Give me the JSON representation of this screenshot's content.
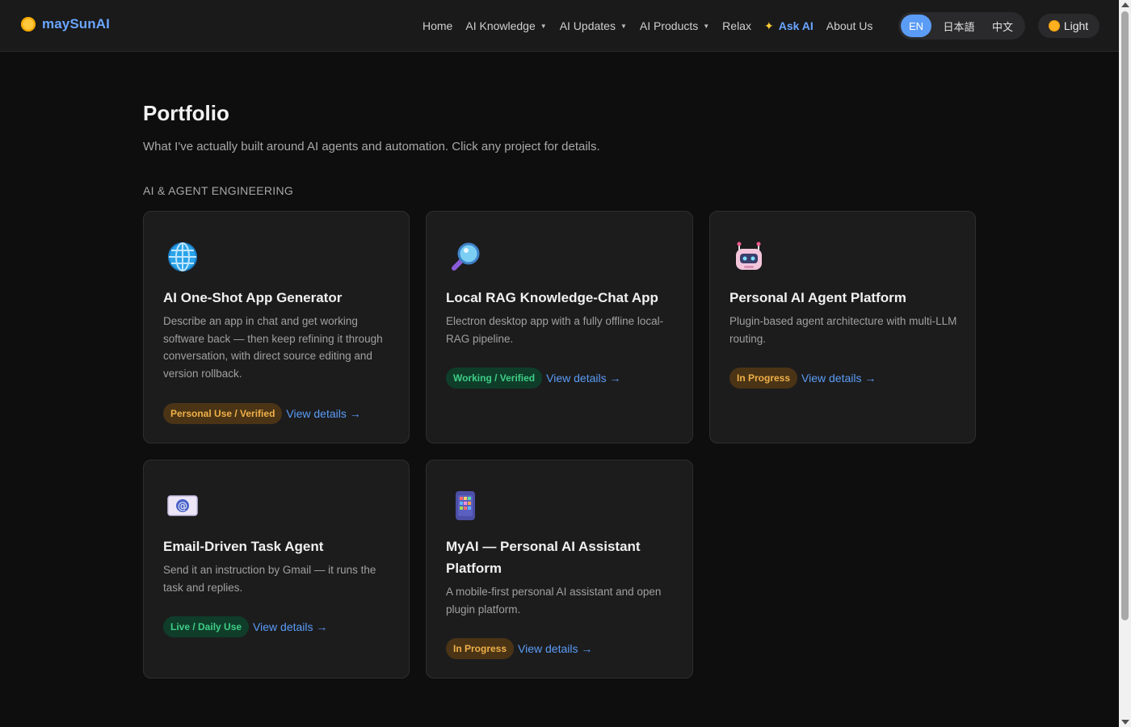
{
  "header": {
    "brand": "maySunAI",
    "nav": [
      {
        "label": "Home"
      },
      {
        "label": "AI Knowledge"
      },
      {
        "label": "AI Updates"
      },
      {
        "label": "AI Products"
      },
      {
        "label": "Relax"
      },
      {
        "label": "Ask AI"
      },
      {
        "label": "About Us"
      }
    ],
    "languages": [
      "EN",
      "日本語",
      "中文"
    ],
    "active_language": "EN",
    "theme_label": "Light"
  },
  "main": {
    "title": "Portfolio",
    "subtitle": "What I've actually built around AI agents and automation. Click any project for details.",
    "section_label": "AI & AGENT ENGINEERING",
    "cards": [
      {
        "icon": "globe-icon",
        "title": "AI One-Shot App Generator",
        "description": "Describe an app in chat and get working software back — then keep refining it through conversation, with direct source editing and version rollback.",
        "badge": "Personal Use / Verified",
        "link": "View details →"
      },
      {
        "icon": "magnifier-icon",
        "title": "Local RAG Knowledge-Chat App",
        "description": "Electron desktop app with a fully offline local-RAG pipeline.",
        "badge": "Working / Verified",
        "link": "View details →"
      },
      {
        "icon": "robot-icon",
        "title": "Personal AI Agent Platform",
        "description": "Plugin-based agent architecture with multi-LLM routing.",
        "badge": "In Progress",
        "link": "View details →"
      },
      {
        "icon": "email-icon",
        "title": "Email-Driven Task Agent",
        "description": "Send it an instruction by Gmail — it runs the task and replies.",
        "badge": "Live / Daily Use",
        "link": "View details →"
      },
      {
        "icon": "phone-apps-icon",
        "title": "MyAI — Personal AI Assistant Platform",
        "description": "A mobile-first personal AI assistant and open plugin platform.",
        "badge": "In Progress",
        "link": "View details →"
      }
    ]
  },
  "colors": {
    "accent": "#5b9cf6",
    "badge_gold": "#f0b04a",
    "badge_green": "#3fce86",
    "background": "#0e0e0f"
  }
}
